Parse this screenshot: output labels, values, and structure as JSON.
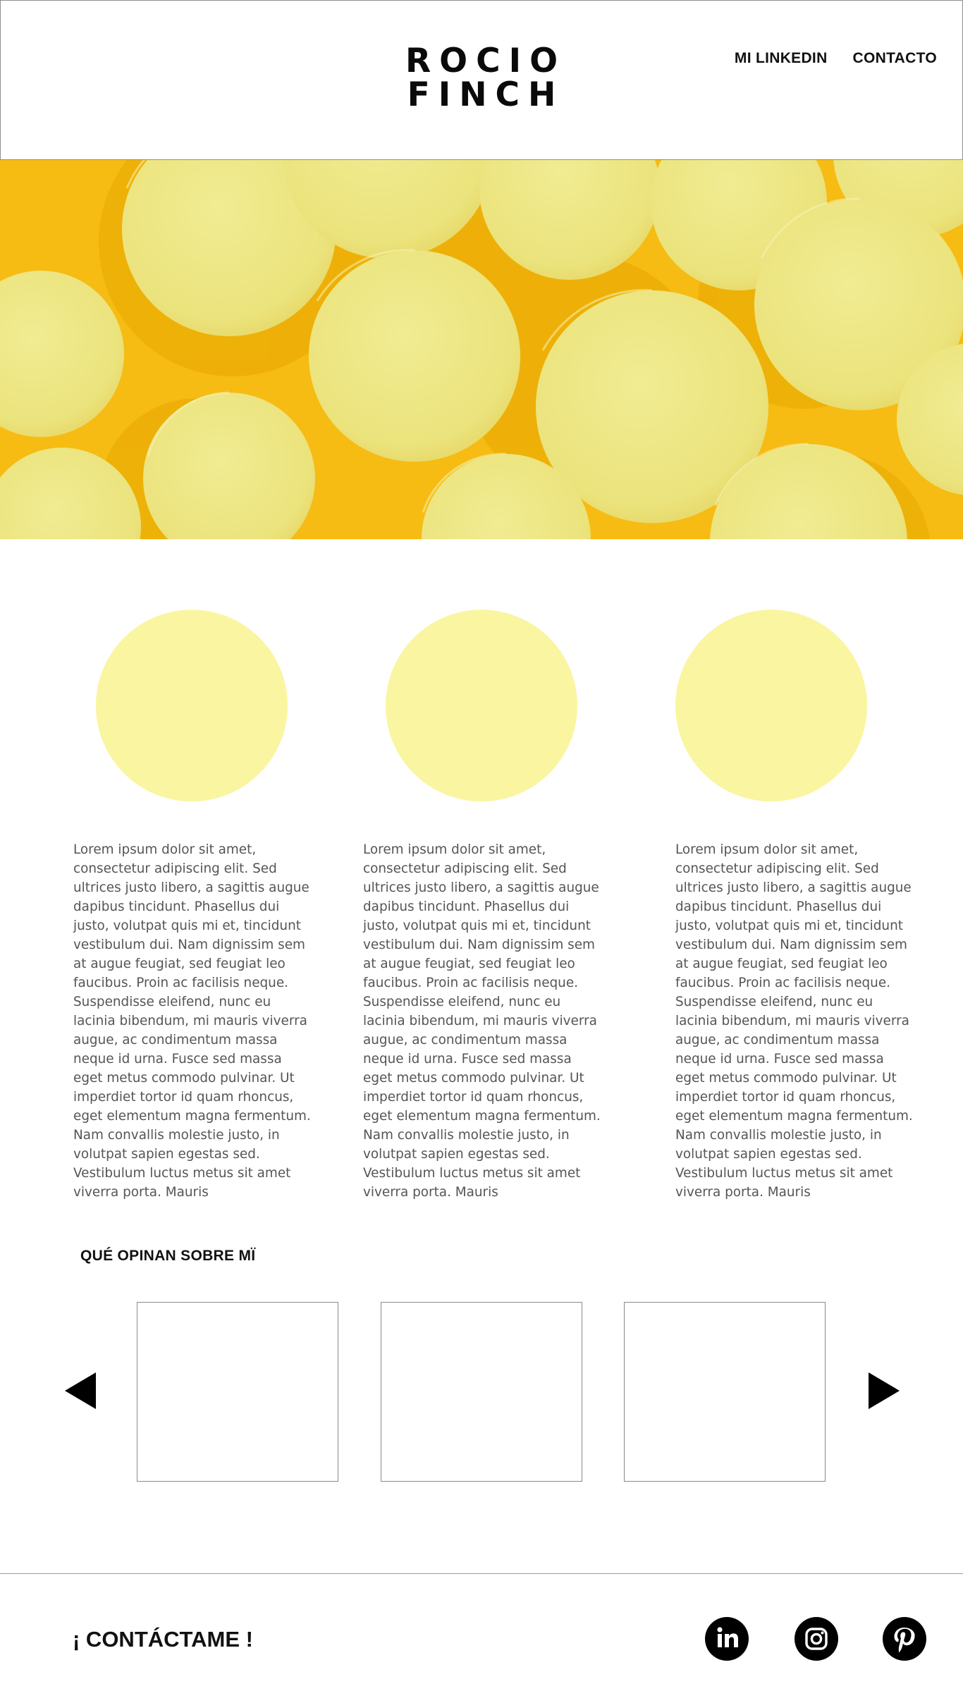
{
  "header": {
    "logo_line1": "ROCIO",
    "logo_line2": "FINCH",
    "nav": [
      {
        "label": "MI LINKEDIN"
      },
      {
        "label": "CONTACTO"
      }
    ]
  },
  "hero": {
    "image": "yellow-discs-photo"
  },
  "features": [
    {
      "text": "Lorem ipsum dolor sit amet, consectetur adipiscing elit. Sed ultrices justo libero, a sagittis augue dapibus tincidunt. Phasellus dui justo, volutpat quis mi et, tincidunt vestibulum dui. Nam dignissim sem at augue feugiat, sed feugiat leo faucibus. Proin ac facilisis neque. Suspendisse eleifend, nunc eu lacinia bibendum, mi mauris viverra augue, ac condimentum massa neque id urna. Fusce sed massa eget metus commodo pulvinar. Ut imperdiet tortor id quam rhoncus, eget elementum magna fermentum. Nam convallis molestie justo, in volutpat sapien egestas sed. Vestibulum luctus metus sit amet viverra porta. Mauris"
    },
    {
      "text": "Lorem ipsum dolor sit amet, consectetur adipiscing elit. Sed ultrices justo libero, a sagittis augue dapibus tincidunt. Phasellus dui justo, volutpat quis mi et, tincidunt vestibulum dui. Nam dignissim sem at augue feugiat, sed feugiat leo faucibus. Proin ac facilisis neque. Suspendisse eleifend, nunc eu lacinia bibendum, mi mauris viverra augue, ac condimentum massa neque id urna. Fusce sed massa eget metus commodo pulvinar. Ut imperdiet tortor id quam rhoncus, eget elementum magna fermentum. Nam convallis molestie justo, in volutpat sapien egestas sed. Vestibulum luctus metus sit amet viverra porta. Mauris"
    },
    {
      "text": "Lorem ipsum dolor sit amet, consectetur adipiscing elit. Sed ultrices justo libero, a sagittis augue dapibus tincidunt. Phasellus dui justo, volutpat quis mi et, tincidunt vestibulum dui. Nam dignissim sem at augue feugiat, sed feugiat leo faucibus. Proin ac facilisis neque. Suspendisse eleifend, nunc eu lacinia bibendum, mi mauris viverra augue, ac condimentum massa neque id urna. Fusce sed massa eget metus commodo pulvinar. Ut imperdiet tortor id quam rhoncus, eget elementum magna fermentum. Nam convallis molestie justo, in volutpat sapien egestas sed. Vestibulum luctus metus sit amet viverra porta. Mauris"
    }
  ],
  "testimonials": {
    "title": "QUÉ OPINAN SOBRE MÏ",
    "prev_icon": "triangle-left-icon",
    "next_icon": "triangle-right-icon"
  },
  "footer": {
    "cta": "¡ CONTÁCTAME !",
    "social": [
      {
        "icon": "linkedin-icon"
      },
      {
        "icon": "instagram-icon"
      },
      {
        "icon": "pinterest-icon"
      }
    ]
  },
  "colors": {
    "accent_yellow": "#faf5a0",
    "hero_yellow": "#f5b90e",
    "text_gray": "#555555",
    "ink": "#111111"
  }
}
